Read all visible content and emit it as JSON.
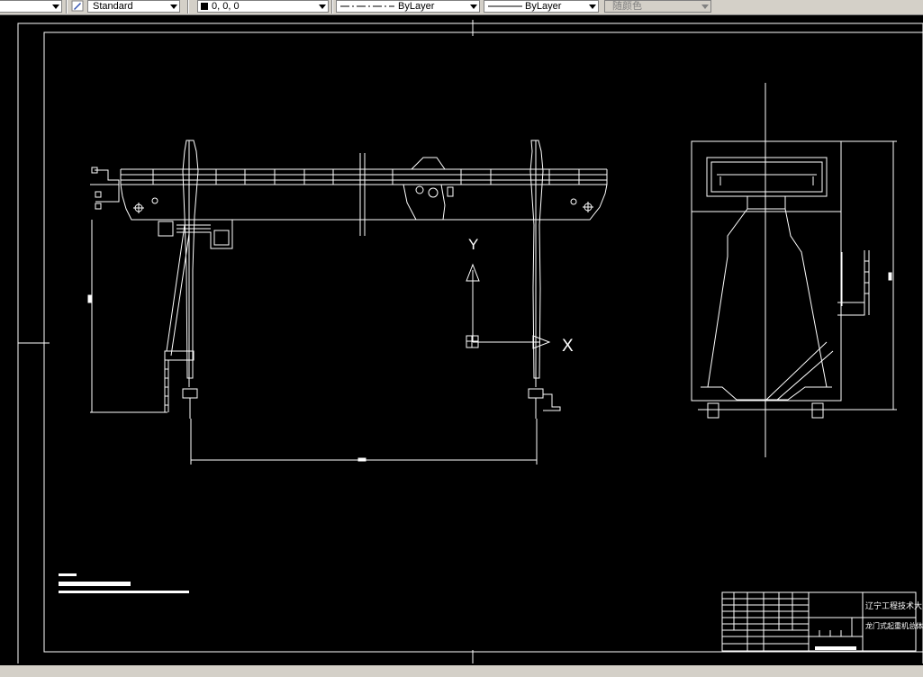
{
  "toolbar": {
    "text_style": "Standard",
    "color_value": "0, 0, 0",
    "linetype": "ByLayer",
    "lineweight": "ByLayer",
    "plot_style": "随颜色"
  },
  "drawing": {
    "axis_y": "Y",
    "axis_x": "X",
    "title_block": {
      "school": "辽宁工程技术大学",
      "drawing_title": "龙门式起重机总体图"
    }
  }
}
